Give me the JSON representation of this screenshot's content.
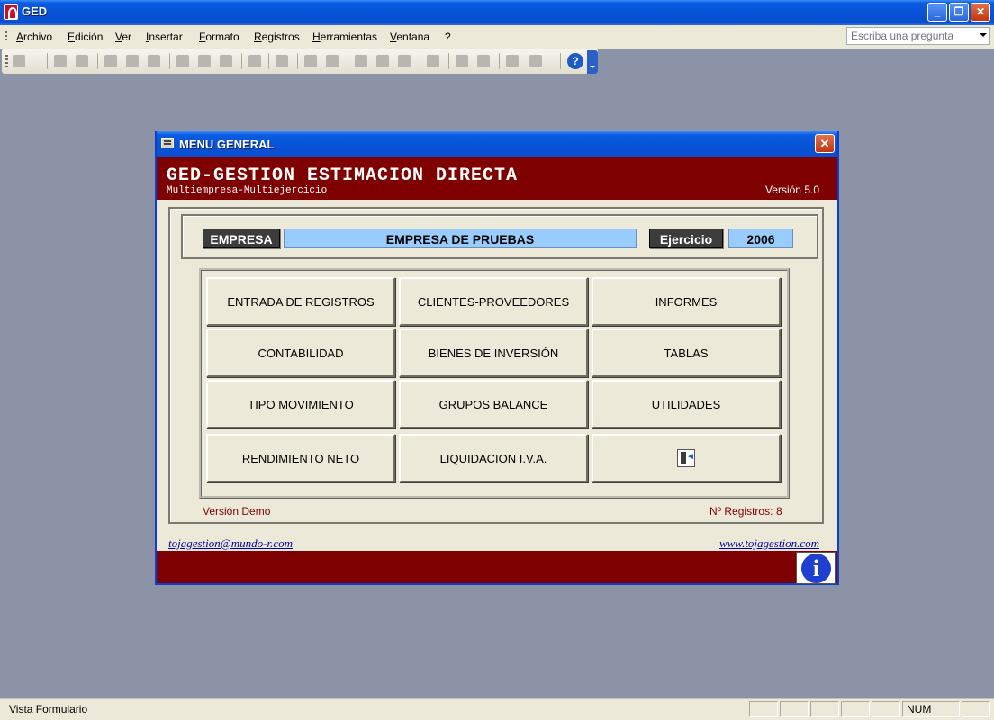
{
  "app": {
    "title": "GED"
  },
  "menubar": {
    "items": [
      "Archivo",
      "Edición",
      "Ver",
      "Insertar",
      "Formato",
      "Registros",
      "Herramientas",
      "Ventana",
      "?"
    ],
    "ask_placeholder": "Escriba una pregunta"
  },
  "form": {
    "title": "MENU GENERAL",
    "header": {
      "app_name": "GED-GESTION ESTIMACION DIRECTA",
      "subtitle": "Multiempresa-Multiejercicio",
      "version": "Versión 5.0"
    },
    "company": {
      "label": "EMPRESA",
      "value": "EMPRESA DE PRUEBAS",
      "year_label": "Ejercicio",
      "year_value": "2006"
    },
    "buttons": [
      "ENTRADA DE REGISTROS",
      "CLIENTES-PROVEEDORES",
      "INFORMES",
      "CONTABILIDAD",
      "BIENES DE INVERSIÓN",
      "TABLAS",
      "TIPO MOVIMIENTO",
      "GRUPOS BALANCE",
      "UTILIDADES",
      "RENDIMIENTO NETO",
      "LIQUIDACION I.V.A."
    ],
    "exit_icon": "exit-door-icon",
    "demo_label": "Versión Demo",
    "records_label": "Nº Registros:",
    "records_value": "8",
    "email_link": "tojagestion@mundo-r.com",
    "web_link": "www.tojagestion.com",
    "info_icon": "i"
  },
  "statusbar": {
    "text": "Vista Formulario",
    "num": "NUM"
  },
  "colors": {
    "header": "#7f0000",
    "value_field": "#99ccff",
    "titlebar": "#0852d6"
  }
}
